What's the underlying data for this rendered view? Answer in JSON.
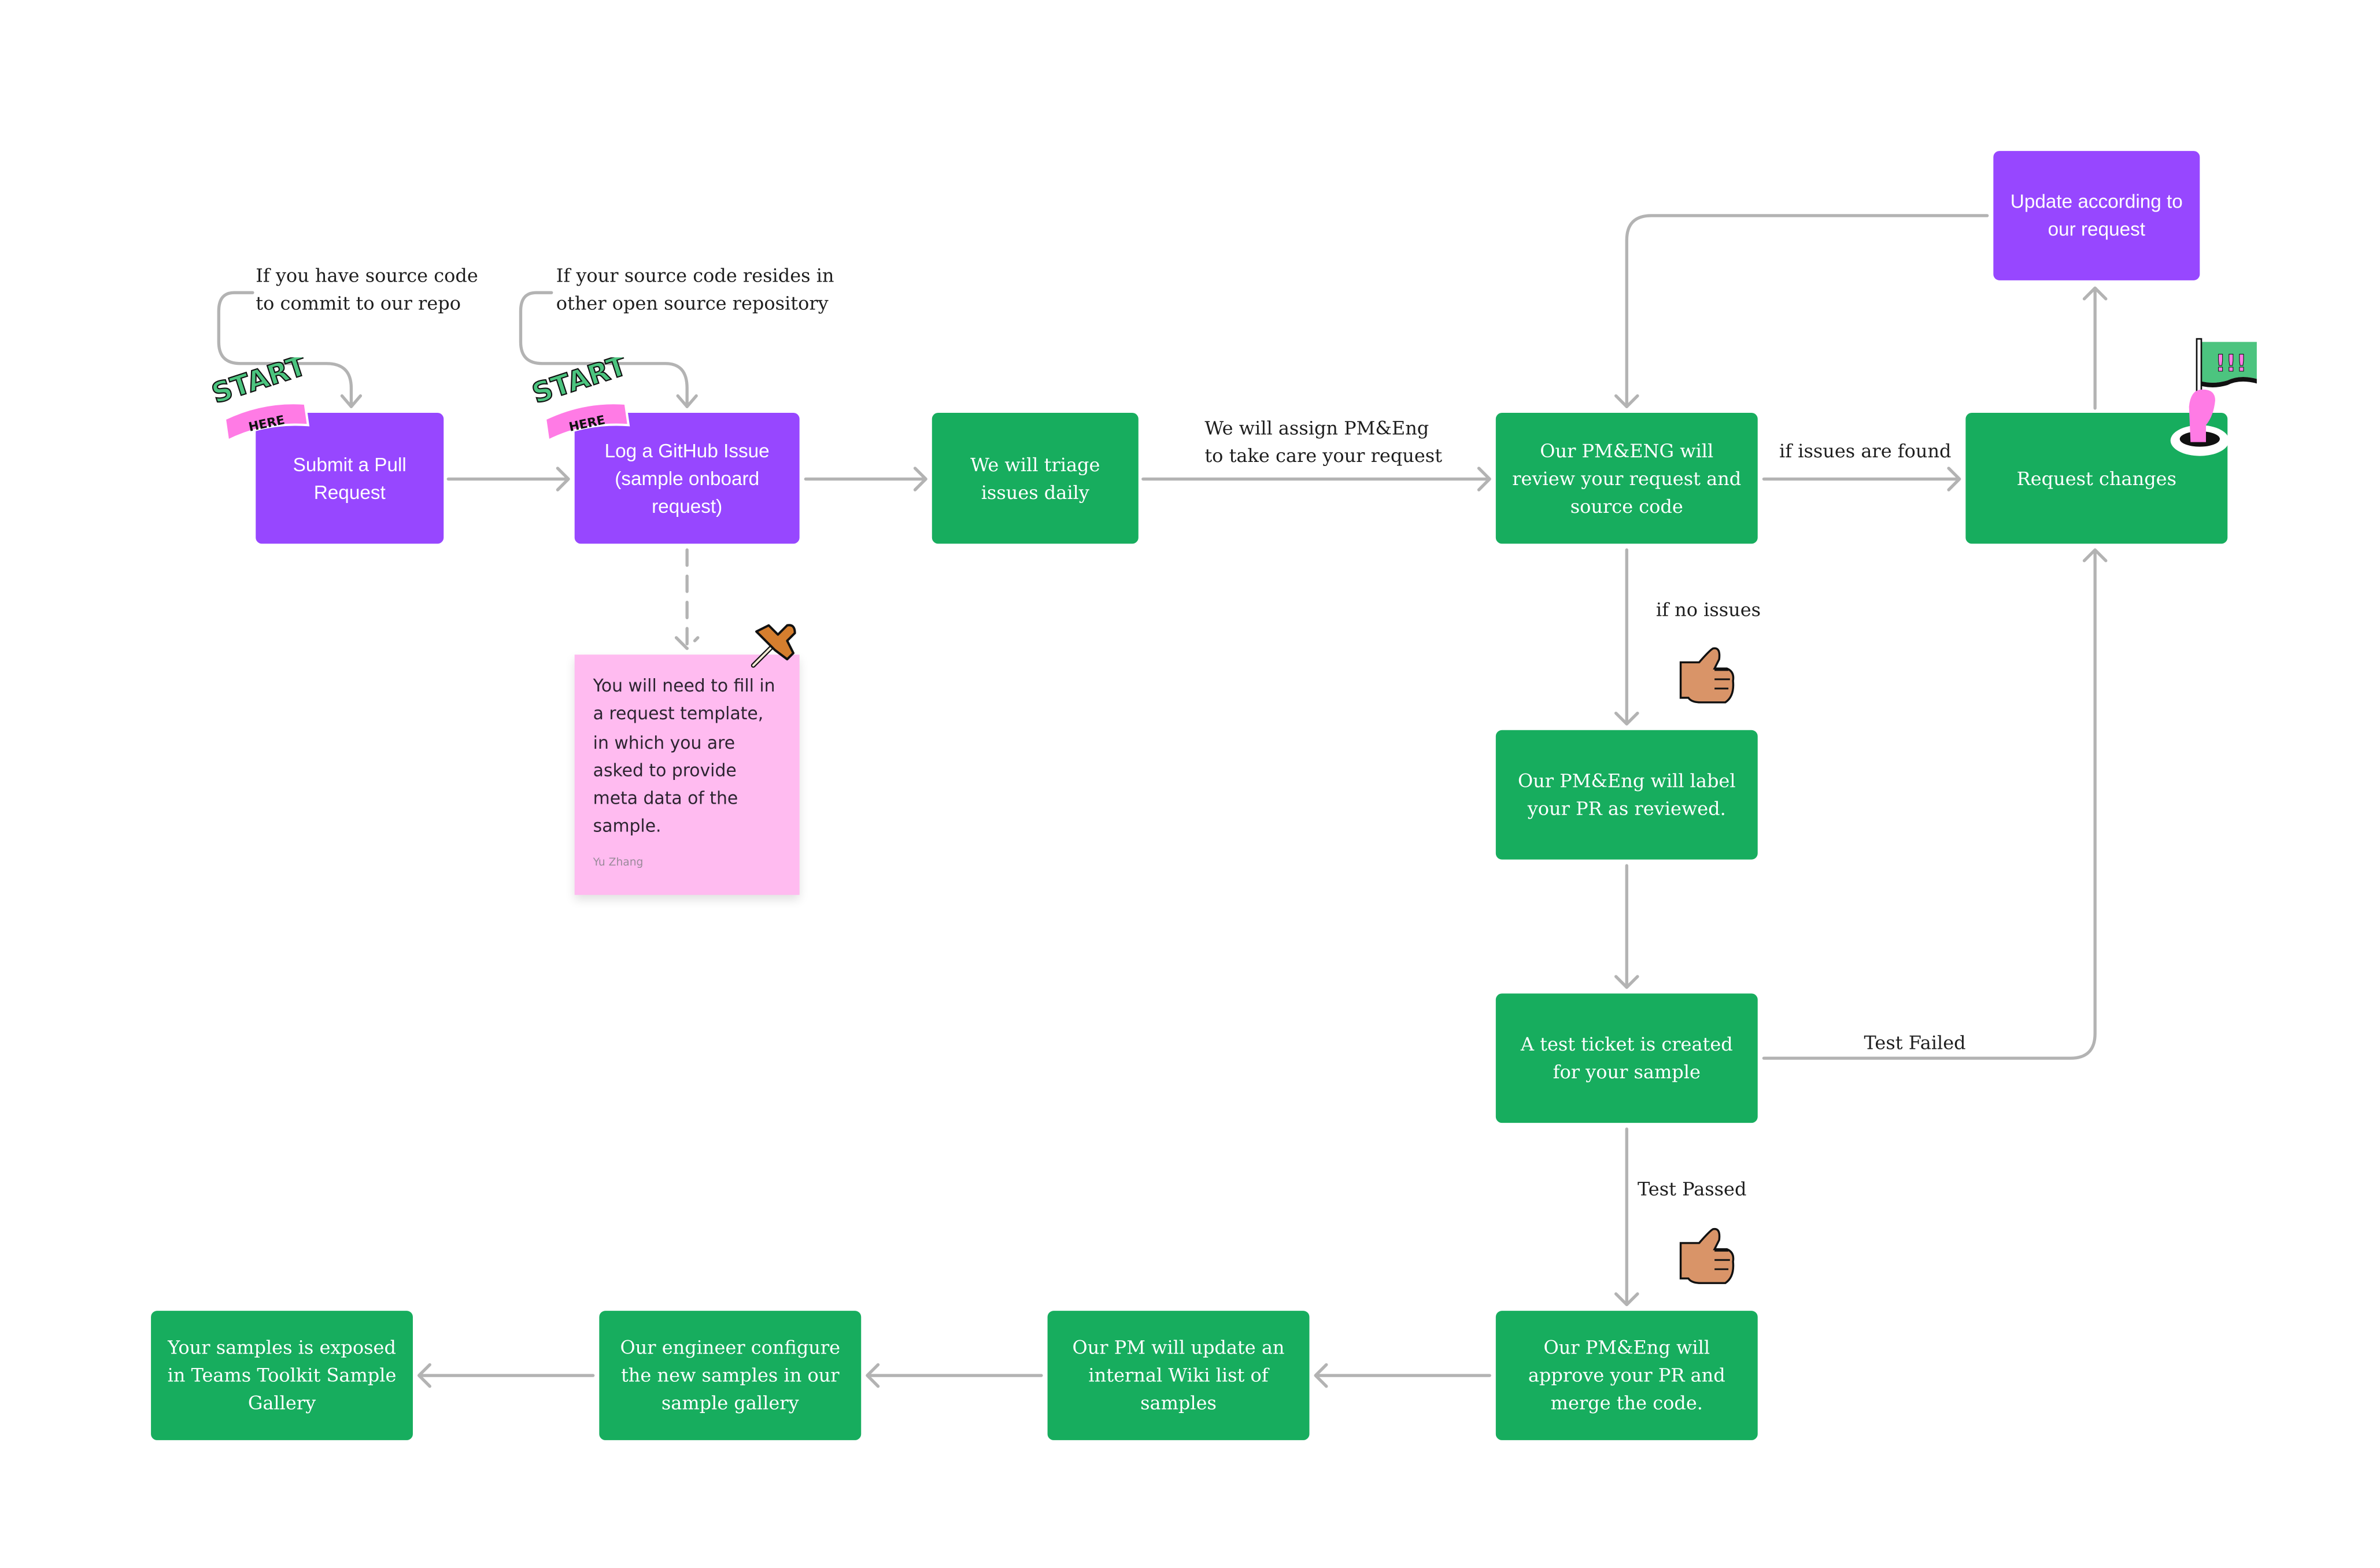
{
  "colors": {
    "purple": "#9747FF",
    "green": "#17AD5E",
    "sticky": "#FFBBF0",
    "connector": "#B3B3B3"
  },
  "nodes": {
    "submit_pr": "Submit a Pull Request",
    "log_issue": "Log a GitHub Issue (sample onboard request)",
    "triage": "We will triage issues daily",
    "review": "Our PM&ENG will review your request and source code",
    "request_changes": "Request changes",
    "update": "Update according to our request",
    "label": "Our PM&Eng will label your PR as reviewed.",
    "test_ticket": "A test ticket is created for your sample",
    "approve": "Our PM&Eng will approve your PR and merge the code.",
    "wiki": "Our PM will update an internal Wiki list of samples",
    "configure": "Our engineer configure the new  samples in our sample gallery",
    "exposed": "Your samples is exposed in Teams Toolkit Sample Gallery"
  },
  "labels": {
    "source_code": "If you have source code\nto commit to our repo",
    "other_repo": "If your source code resides in\nother open source repository",
    "assign": "We will assign PM&Eng\nto take care your request",
    "issues_found": "if issues are found",
    "no_issues": "if no issues",
    "test_failed": "Test Failed",
    "test_passed": "Test Passed"
  },
  "sticky": {
    "text": "You will need to fill in a request template, in which you are asked to provide meta data of the sample.",
    "author": "Yu Zhang"
  },
  "stickers": {
    "start": "START",
    "here": "HERE",
    "flag": "!!!",
    "icons": [
      "start-here-sticker",
      "pushpin-icon",
      "thumbs-up-icon",
      "hand-flag-icon"
    ]
  }
}
